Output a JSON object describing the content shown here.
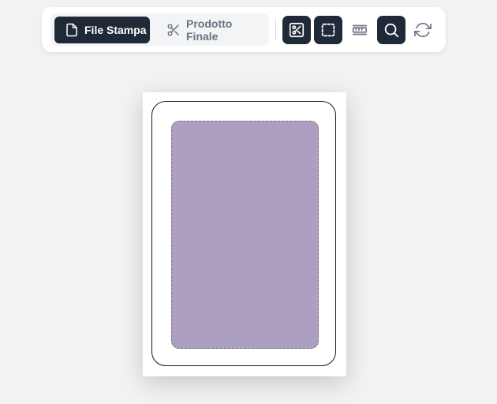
{
  "toolbar": {
    "view_modes": [
      {
        "label": "File Stampa",
        "icon": "file-icon",
        "active": true
      },
      {
        "label": "Prodotto Finale",
        "icon": "scissors-icon",
        "active": false
      }
    ],
    "tools": [
      {
        "icon": "cut-lines-icon",
        "active": true
      },
      {
        "icon": "safe-area-icon",
        "active": true
      },
      {
        "icon": "ruler-icon",
        "active": false
      },
      {
        "icon": "zoom-icon",
        "active": true
      },
      {
        "icon": "refresh-icon",
        "active": false
      }
    ]
  },
  "colors": {
    "active_button_bg": "#1f2937",
    "artwork_fill": "#ad9fbf",
    "page_bg": "#f2f2f2"
  }
}
